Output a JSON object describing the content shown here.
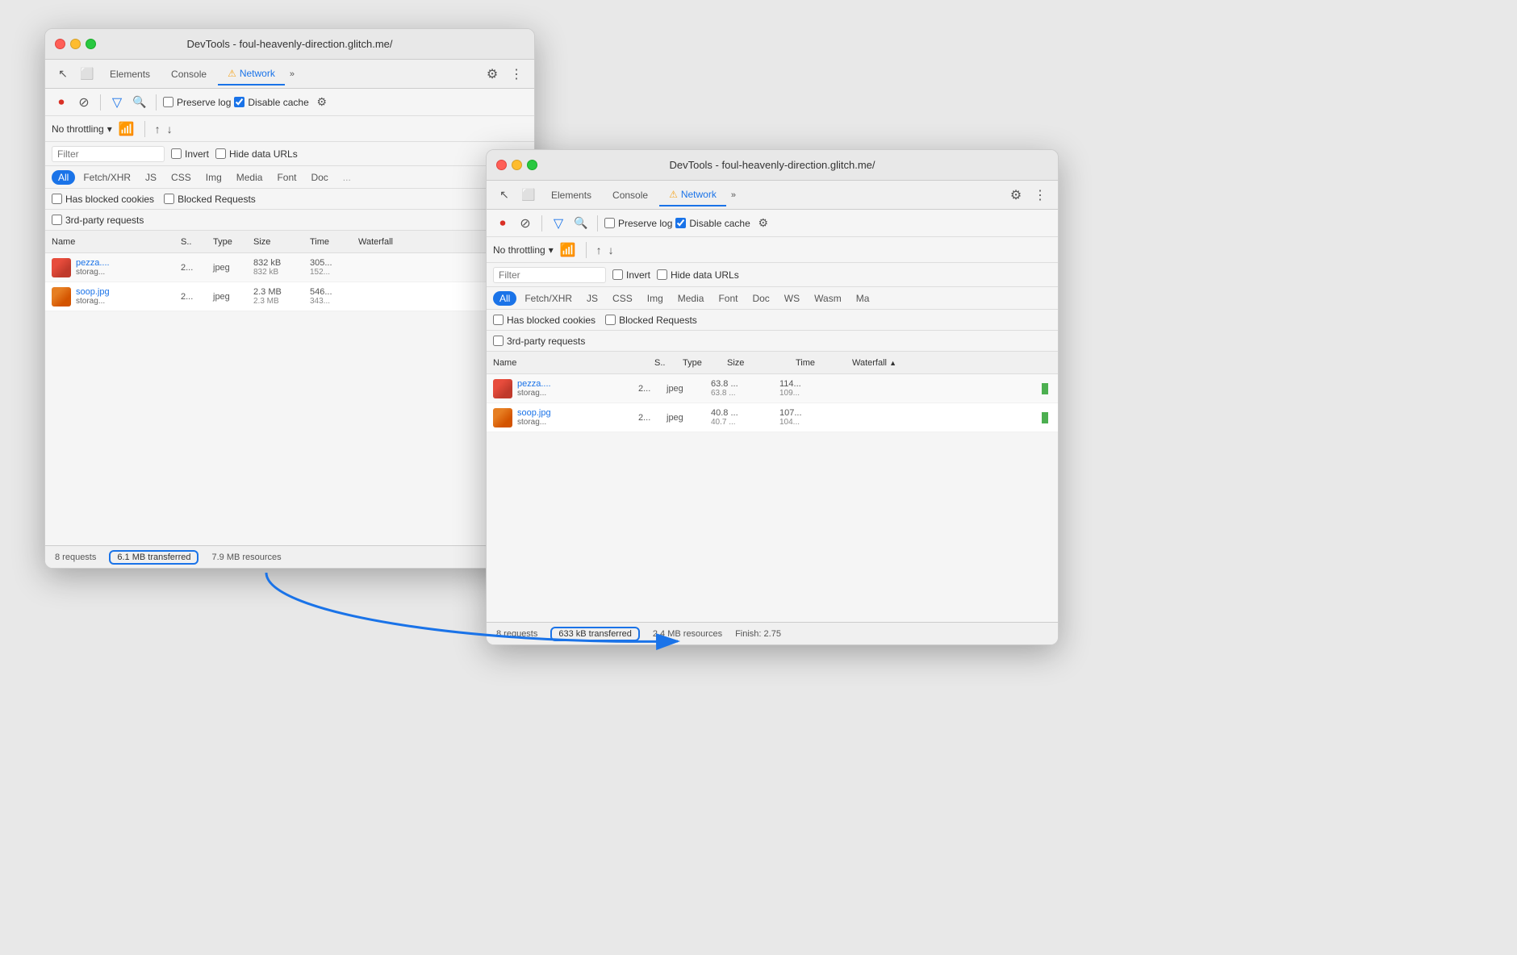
{
  "window1": {
    "title": "DevTools - foul-heavenly-direction.glitch.me/",
    "tabs": [
      "Elements",
      "Console",
      "Network"
    ],
    "active_tab": "Network",
    "toolbar": {
      "preserve_log": "Preserve log",
      "disable_cache": "Disable cache",
      "disable_cache_checked": true
    },
    "throttling": {
      "label": "No throttling"
    },
    "filter_placeholder": "Filter",
    "invert_label": "Invert",
    "hide_data_urls_label": "Hide data URLs",
    "filter_tabs": [
      "All",
      "Fetch/XHR",
      "JS",
      "CSS",
      "Img",
      "Media",
      "Font",
      "Doc"
    ],
    "active_filter": "All",
    "extra_filters": {
      "has_blocked_cookies": "Has blocked cookies",
      "blocked_requests": "Blocked Requests",
      "third_party": "3rd-party requests"
    },
    "table_headers": {
      "name": "Name",
      "status": "S..",
      "type": "Type",
      "size": "Size",
      "time": "Time",
      "waterfall": "Waterfall"
    },
    "rows": [
      {
        "name": "pezza....",
        "sub": "storag...",
        "status": "2...",
        "type": "jpeg",
        "size": "832 kB",
        "size2": "832 kB",
        "time": "305...",
        "time2": "152..."
      },
      {
        "name": "soop.jpg",
        "sub": "storag...",
        "status": "2...",
        "type": "jpeg",
        "size": "2.3 MB",
        "size2": "2.3 MB",
        "time": "546...",
        "time2": "343..."
      }
    ],
    "status_bar": {
      "requests": "8 requests",
      "transferred": "6.1 MB transferred",
      "resources": "7.9 MB resources"
    }
  },
  "window2": {
    "title": "DevTools - foul-heavenly-direction.glitch.me/",
    "tabs": [
      "Elements",
      "Console",
      "Network"
    ],
    "active_tab": "Network",
    "toolbar": {
      "preserve_log": "Preserve log",
      "disable_cache": "Disable cache",
      "disable_cache_checked": true
    },
    "throttling": {
      "label": "No throttling"
    },
    "filter_placeholder": "Filter",
    "invert_label": "Invert",
    "hide_data_urls_label": "Hide data URLs",
    "filter_tabs": [
      "All",
      "Fetch/XHR",
      "JS",
      "CSS",
      "Img",
      "Media",
      "Font",
      "Doc",
      "WS",
      "Wasm",
      "Ma"
    ],
    "active_filter": "All",
    "extra_filters": {
      "has_blocked_cookies": "Has blocked cookies",
      "blocked_requests": "Blocked Requests",
      "third_party": "3rd-party requests"
    },
    "table_headers": {
      "name": "Name",
      "status": "S..",
      "type": "Type",
      "size": "Size",
      "time": "Time",
      "waterfall": "Waterfall"
    },
    "rows": [
      {
        "name": "pezza....",
        "sub": "storag...",
        "status": "2...",
        "type": "jpeg",
        "size": "63.8 ...",
        "size2": "63.8 ...",
        "time": "114...",
        "time2": "109..."
      },
      {
        "name": "soop.jpg",
        "sub": "storag...",
        "status": "2...",
        "type": "jpeg",
        "size": "40.8 ...",
        "size2": "40.7 ...",
        "time": "107...",
        "time2": "104..."
      }
    ],
    "status_bar": {
      "requests": "8 requests",
      "transferred": "633 kB transferred",
      "resources": "2.4 MB resources",
      "finish": "Finish: 2.75"
    }
  },
  "icons": {
    "record": "⏺",
    "clear": "🚫",
    "filter": "▼",
    "search": "🔍",
    "gear": "⚙",
    "dots": "⋮",
    "more": "»",
    "upload": "↑",
    "download": "↓",
    "warning": "⚠",
    "sort_asc": "▲",
    "cursor": "↖",
    "inspect": "□"
  }
}
